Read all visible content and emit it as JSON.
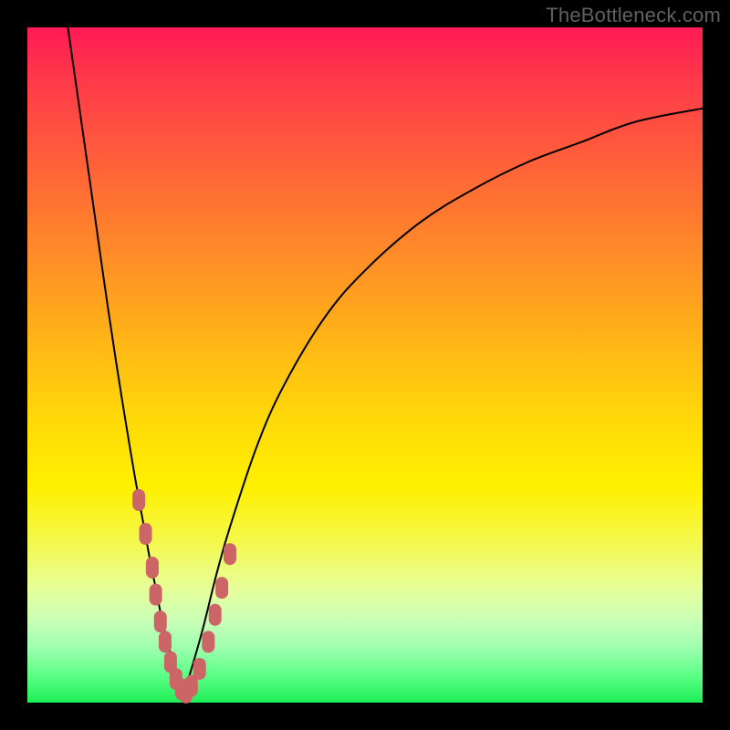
{
  "watermark": "TheBottleneck.com",
  "colors": {
    "frame": "#000000",
    "curve": "#000000",
    "marker": "#cc6666",
    "gradient_stops": [
      "#ff1a55",
      "#ff3a49",
      "#ff5a3c",
      "#ff7a2f",
      "#ff9a22",
      "#ffba15",
      "#ffd908",
      "#fff000",
      "#f4f84a",
      "#e8ff99",
      "#c8ffb8",
      "#9cffad",
      "#5cff86",
      "#1eee58"
    ]
  },
  "chart_data": {
    "type": "line",
    "title": "",
    "xlabel": "",
    "ylabel": "",
    "xlim": [
      0,
      100
    ],
    "ylim": [
      0,
      100
    ],
    "legend": false,
    "grid": false,
    "series": [
      {
        "name": "left-branch",
        "x": [
          6,
          8,
          10,
          12,
          14,
          16,
          18,
          19,
          20,
          21,
          22,
          23
        ],
        "y": [
          100,
          86,
          72,
          58,
          45,
          33,
          22,
          17,
          12,
          8,
          4,
          1
        ]
      },
      {
        "name": "right-branch",
        "x": [
          23,
          24,
          26,
          28,
          30,
          34,
          38,
          44,
          50,
          58,
          66,
          74,
          82,
          90,
          100
        ],
        "y": [
          1,
          4,
          11,
          19,
          26,
          38,
          47,
          57,
          64,
          71,
          76,
          80,
          83,
          86,
          88
        ]
      }
    ],
    "markers": {
      "name": "highlighted-points",
      "color": "#cc6666",
      "points": [
        {
          "x": 16.5,
          "y": 30
        },
        {
          "x": 17.5,
          "y": 25
        },
        {
          "x": 18.5,
          "y": 20
        },
        {
          "x": 19,
          "y": 16
        },
        {
          "x": 19.7,
          "y": 12
        },
        {
          "x": 20.4,
          "y": 9
        },
        {
          "x": 21.2,
          "y": 6
        },
        {
          "x": 22,
          "y": 3.5
        },
        {
          "x": 22.8,
          "y": 2
        },
        {
          "x": 23.5,
          "y": 1.5
        },
        {
          "x": 24.3,
          "y": 2.5
        },
        {
          "x": 25.5,
          "y": 5
        },
        {
          "x": 26.8,
          "y": 9
        },
        {
          "x": 27.8,
          "y": 13
        },
        {
          "x": 28.8,
          "y": 17
        },
        {
          "x": 30,
          "y": 22
        }
      ]
    }
  }
}
